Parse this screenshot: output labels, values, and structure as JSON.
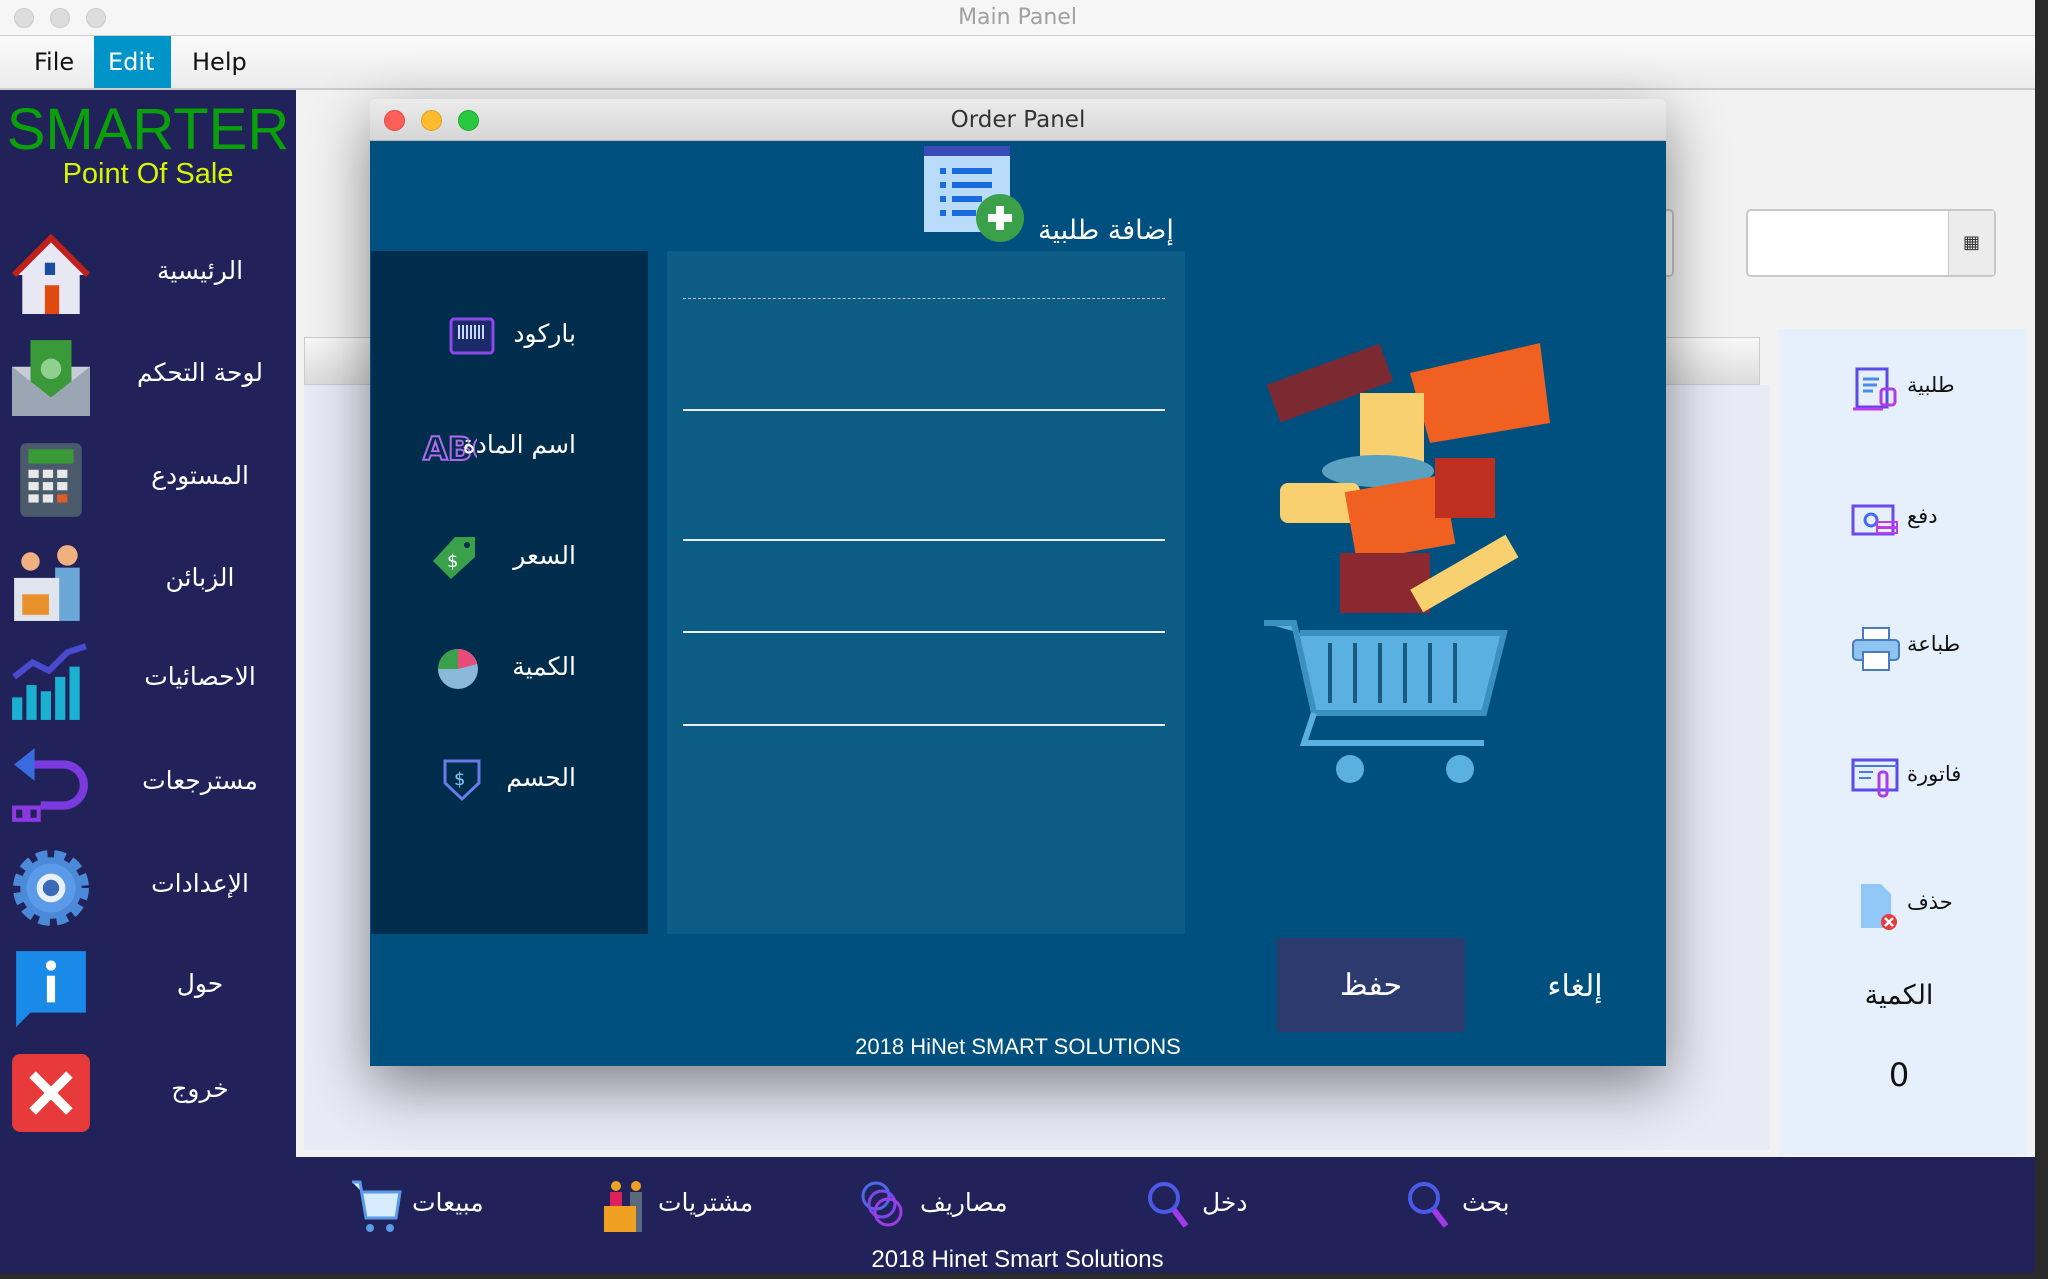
{
  "window": {
    "title": "Main Panel"
  },
  "menu": [
    "File",
    "Edit",
    "Help"
  ],
  "brand": {
    "name": "SMARTER",
    "subtitle": "Point Of Sale"
  },
  "sidebar": {
    "items": [
      {
        "label": "الرئيسية",
        "icon": "home-icon"
      },
      {
        "label": "لوحة التحكم",
        "icon": "money-envelope-icon"
      },
      {
        "label": "المستودع",
        "icon": "calculator-icon"
      },
      {
        "label": "الزبائن",
        "icon": "customers-icon"
      },
      {
        "label": "الاحصائيات",
        "icon": "bar-chart-icon"
      },
      {
        "label": "مسترجعات",
        "icon": "return-arrow-icon"
      },
      {
        "label": "الإعدادات",
        "icon": "gear-icon"
      },
      {
        "label": "حول",
        "icon": "info-icon"
      },
      {
        "label": "خروج",
        "icon": "close-icon"
      }
    ]
  },
  "right_panel": {
    "items": [
      {
        "label": "طلبية",
        "icon": "order-icon"
      },
      {
        "label": "دفع",
        "icon": "payment-icon"
      },
      {
        "label": "طباعة",
        "icon": "printer-icon"
      },
      {
        "label": "فاتورة",
        "icon": "invoice-icon"
      },
      {
        "label": "حذف",
        "icon": "delete-file-icon"
      }
    ],
    "quantity_label": "الكمية",
    "quantity_value": "0"
  },
  "bottom_bar": {
    "items": [
      {
        "label": "مبيعات",
        "icon": "cart-icon"
      },
      {
        "label": "مشتريات",
        "icon": "purchases-icon"
      },
      {
        "label": "مصاريف",
        "icon": "coins-icon"
      },
      {
        "label": "دخل",
        "icon": "search-icon"
      },
      {
        "label": "بحث",
        "icon": "search-icon"
      }
    ],
    "footer": "2018 Hinet Smart Solutions"
  },
  "dialog": {
    "title": "Order Panel",
    "header": "إضافة طلبية",
    "fields": [
      {
        "label": "باركود",
        "icon": "barcode-icon",
        "value": ""
      },
      {
        "label": "اسم المادة",
        "icon": "abc-icon",
        "value": ""
      },
      {
        "label": "السعر",
        "icon": "price-tag-icon",
        "value": ""
      },
      {
        "label": "الكمية",
        "icon": "pie-chart-icon",
        "value": ""
      },
      {
        "label": "الحسم",
        "icon": "discount-icon",
        "value": ""
      }
    ],
    "save": "حفظ",
    "cancel": "إلغاء",
    "footer": "2018 HiNet SMART SOLUTIONS"
  },
  "colors": {
    "sidebar": "#22225a",
    "dialog": "#00507f",
    "accent_green": "#0aa00a",
    "accent_yellow": "#d6f500",
    "menu_highlight": "#0094c8"
  }
}
